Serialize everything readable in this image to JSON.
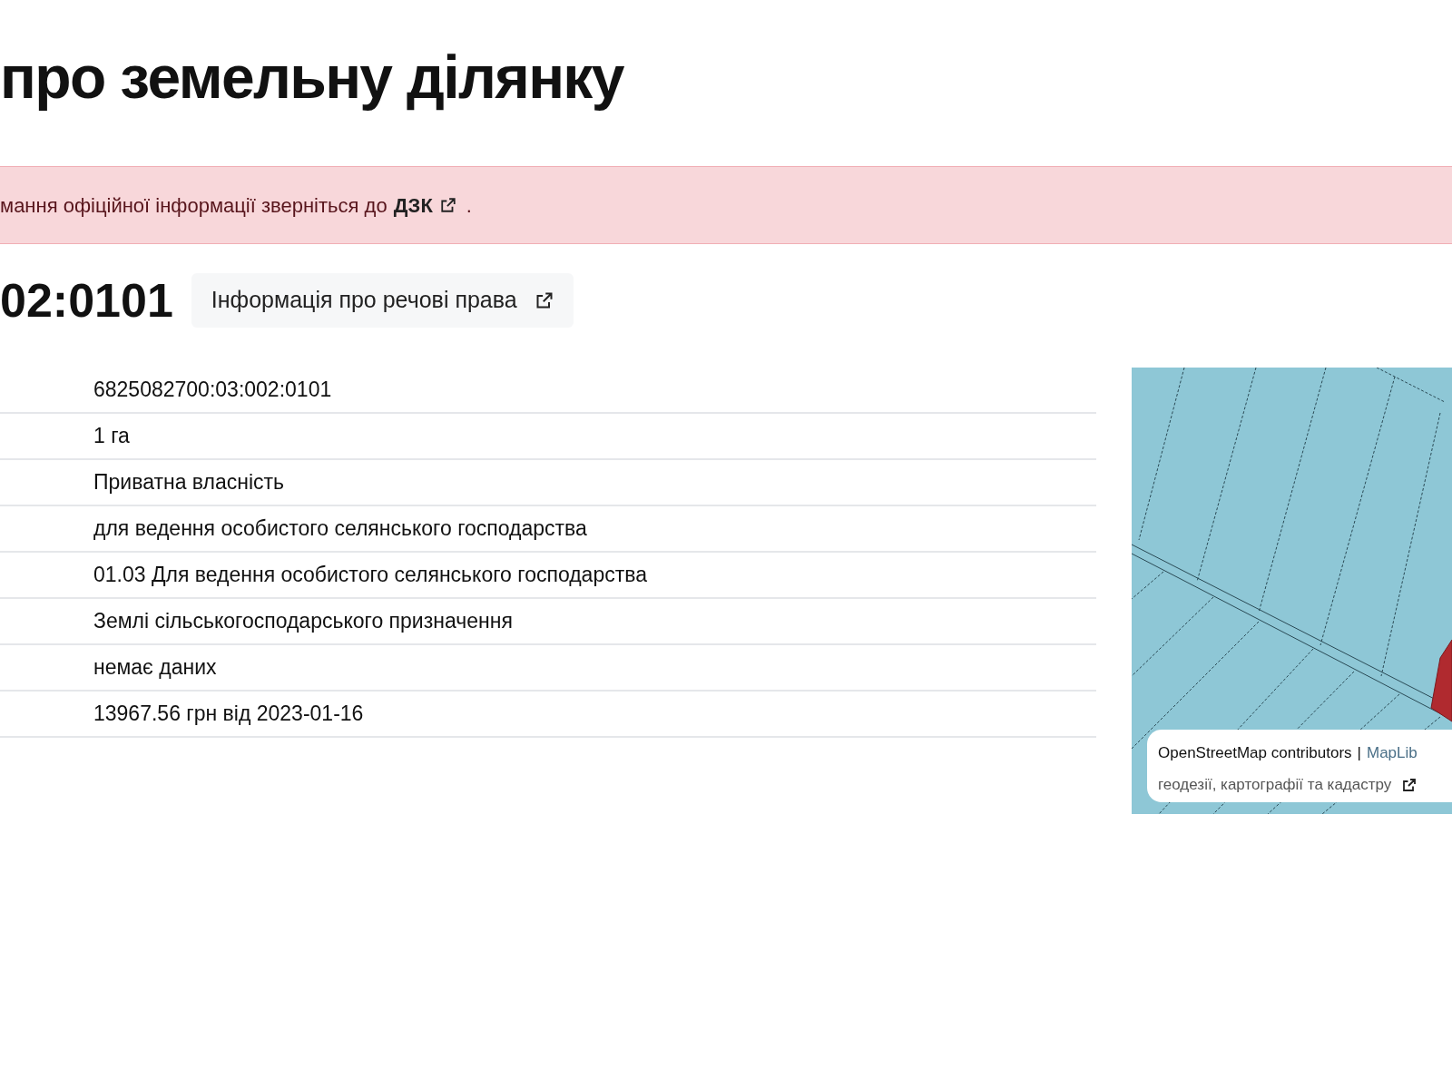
{
  "title": "про земельну ділянку",
  "alert": {
    "text": "мання офіційної інформації зверніться до",
    "link": "ДЗК",
    "after": "."
  },
  "parcel": {
    "number": "02:0101",
    "rights_button": "Інформація про речові права"
  },
  "rows": [
    {
      "value": "6825082700:03:002:0101"
    },
    {
      "value": "1 га"
    },
    {
      "value": "Приватна власність"
    },
    {
      "value": "для ведення особистого селянського господарства"
    },
    {
      "value": "01.03 Для ведення особистого селянського господарства"
    },
    {
      "value": "Землі сільськогосподарського призначення"
    },
    {
      "value": "немає даних"
    },
    {
      "value": "13967.56 грн від 2023-01-16"
    }
  ],
  "map": {
    "attribution": {
      "osm": "OpenStreetMap contributors",
      "separator": "|",
      "maplib": "MapLib",
      "agency": "геодезії, картографії та кадастру"
    }
  }
}
